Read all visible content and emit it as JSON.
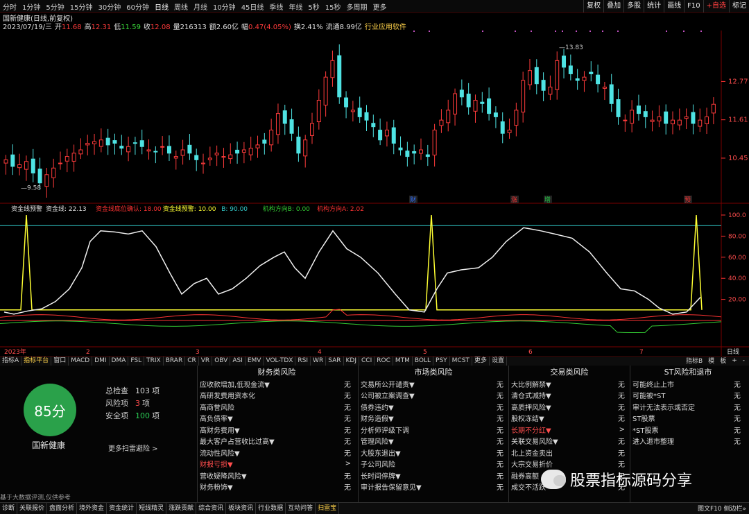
{
  "periods": [
    "分时",
    "1分钟",
    "5分钟",
    "15分钟",
    "30分钟",
    "60分钟",
    "日线",
    "周线",
    "月线",
    "10分钟",
    "45日线",
    "季线",
    "年线",
    "5秒",
    "15秒",
    "多周期",
    "更多"
  ],
  "active_period": "日线",
  "right_tools": [
    "复权",
    "叠加",
    "多股",
    "统计",
    "画线",
    "F10",
    "+自选",
    "标记"
  ],
  "title": "国新健康(日线,前复权)",
  "quote": {
    "date": "2023/07/19/三",
    "open_label": "开",
    "open": "11.68",
    "high_label": "高",
    "high": "12.31",
    "low_label": "低",
    "low": "11.59",
    "close_label": "收",
    "close": "12.08",
    "vol_label": "量",
    "vol": "216313",
    "amount_label": "额",
    "amount": "2.60亿",
    "chg_label": "幅",
    "chg": "0.47(4.05%)",
    "turnover_label": "换",
    "turnover": "2.41%",
    "float_label": "流通",
    "float": "8.99亿",
    "industry": "行业应用软件"
  },
  "price_axis": [
    "12.77",
    "11.61",
    "10.45"
  ],
  "high_note": "13.83",
  "low_note": "9.58",
  "event_marks": [
    {
      "t": "财",
      "c": "#2f6fff"
    },
    {
      "t": "涨",
      "c": "#ff3333"
    },
    {
      "t": "增",
      "c": "#22cc44"
    },
    {
      "t": "预",
      "c": "#ff3333"
    }
  ],
  "indicator": {
    "name": "资金线预警",
    "items": [
      {
        "label": "资金线",
        "value": "22.13",
        "color": "#e0e0e0"
      },
      {
        "label": "资金线底位确认",
        "value": "18.00",
        "color": "#ff3333"
      },
      {
        "label": "资金线预警",
        "value": "10.00",
        "color": "#ffff33"
      },
      {
        "label": "B",
        "value": "90.00",
        "color": "#33cccc"
      },
      {
        "label": "机构方向B",
        "value": "0.00",
        "color": "#33cc33"
      },
      {
        "label": "机构方向A",
        "value": "2.02",
        "color": "#ff3333"
      }
    ]
  },
  "ind_axis": [
    "100.0",
    "80.00",
    "60.00",
    "40.00",
    "20.00"
  ],
  "date_axis": [
    "2023年",
    "2",
    "3",
    "4",
    "5",
    "6",
    "7"
  ],
  "axis_mode": "日线",
  "indicator_tabs": [
    "指标A",
    "指标平台",
    "窗口",
    "MACD",
    "DMI",
    "DMA",
    "FSL",
    "TRIX",
    "BRAR",
    "CR",
    "VR",
    "OBV",
    "ASI",
    "EMV",
    "VOL-TDX",
    "RSI",
    "WR",
    "SAR",
    "KDJ",
    "CCI",
    "ROC",
    "MTM",
    "BOLL",
    "PSY",
    "MCST",
    "更多",
    "设置"
  ],
  "active_indicator_tab": "指标平台",
  "indicator_right": [
    "指标B",
    "模",
    "板",
    "+",
    "-"
  ],
  "score": "85分",
  "stock_name": "国新健康",
  "stats": [
    {
      "label": "总检查",
      "value": "103",
      "unit": "项",
      "color": "#d8d8d8"
    },
    {
      "label": "风险项",
      "value": "3",
      "unit": "项",
      "color": "#ff4d4d"
    },
    {
      "label": "安全项",
      "value": "100",
      "unit": "项",
      "color": "#2acc55"
    }
  ],
  "more_scan": "更多扫雷避险 >",
  "disclaimer": "基于大数据评测,仅供参考",
  "risk_columns": [
    {
      "title": "财务类风险",
      "rows": [
        {
          "l": "应收款增加,低现金流▼",
          "v": "无"
        },
        {
          "l": "高研发费用资本化",
          "v": "无"
        },
        {
          "l": "高商誉风险",
          "v": "无"
        },
        {
          "l": "高负债率▼",
          "v": "无"
        },
        {
          "l": "高财务费用▼",
          "v": "无"
        },
        {
          "l": "最大客户占营收比过高▼",
          "v": "无"
        },
        {
          "l": "流动性风险▼",
          "v": "无"
        },
        {
          "l": "财报亏损▼",
          "v": ">",
          "red": true
        },
        {
          "l": "营收疑降风险▼",
          "v": "无"
        },
        {
          "l": "财务粉饰▼",
          "v": "无"
        }
      ]
    },
    {
      "title": "市场类风险",
      "rows": [
        {
          "l": "交易所公开谴责▼",
          "v": "无"
        },
        {
          "l": "公司被立案调查▼",
          "v": "无"
        },
        {
          "l": "债券违约▼",
          "v": "无"
        },
        {
          "l": "财务造假▼",
          "v": "无"
        },
        {
          "l": "分析师评级下调",
          "v": "无"
        },
        {
          "l": "管理风险▼",
          "v": "无"
        },
        {
          "l": "大股东退出▼",
          "v": "无"
        },
        {
          "l": "子公司风险",
          "v": "无"
        },
        {
          "l": "长时间停牌▼",
          "v": "无"
        },
        {
          "l": "审计报告保留意见▼",
          "v": "无"
        }
      ]
    },
    {
      "title": "交易类风险",
      "rows": [
        {
          "l": "大比例解禁▼",
          "v": "无"
        },
        {
          "l": "清仓式减持▼",
          "v": "无"
        },
        {
          "l": "高质押风险▼",
          "v": "无"
        },
        {
          "l": "股权冻结▼",
          "v": "无"
        },
        {
          "l": "长期不分红▼",
          "v": ">",
          "red": true
        },
        {
          "l": "关联交易风险▼",
          "v": "无"
        },
        {
          "l": "北上资金卖出",
          "v": "无"
        },
        {
          "l": "大宗交易折价",
          "v": "无"
        },
        {
          "l": "融券高额",
          "v": "无"
        },
        {
          "l": "成交不活跃",
          "v": "无"
        }
      ]
    },
    {
      "title": "ST风险和退市",
      "rows": [
        {
          "l": "可能终止上市",
          "v": "无"
        },
        {
          "l": "可能被*ST",
          "v": "无"
        },
        {
          "l": "审计无法表示或否定",
          "v": "无"
        },
        {
          "l": "ST股票",
          "v": "无"
        },
        {
          "l": "*ST股票",
          "v": "无"
        },
        {
          "l": "进入退市整理",
          "v": "无"
        }
      ]
    }
  ],
  "bottom_tabs": [
    "诊断",
    "关联报价",
    "盘面分析",
    "境外资金",
    "资金统计",
    "短线精灵",
    "涨跌贡献",
    "综合资讯",
    "板块资讯",
    "行业数据",
    "互动问答",
    "扫雷宝"
  ],
  "active_bottom_tab": "扫雷宝",
  "bottom_right": "图文F10 侧边栏»",
  "watermark": "股票指标源码分享",
  "colors": {
    "up": "#ff3b3b",
    "down": "#4fe3e3",
    "background": "#000000",
    "score": "#2aa14a"
  }
}
